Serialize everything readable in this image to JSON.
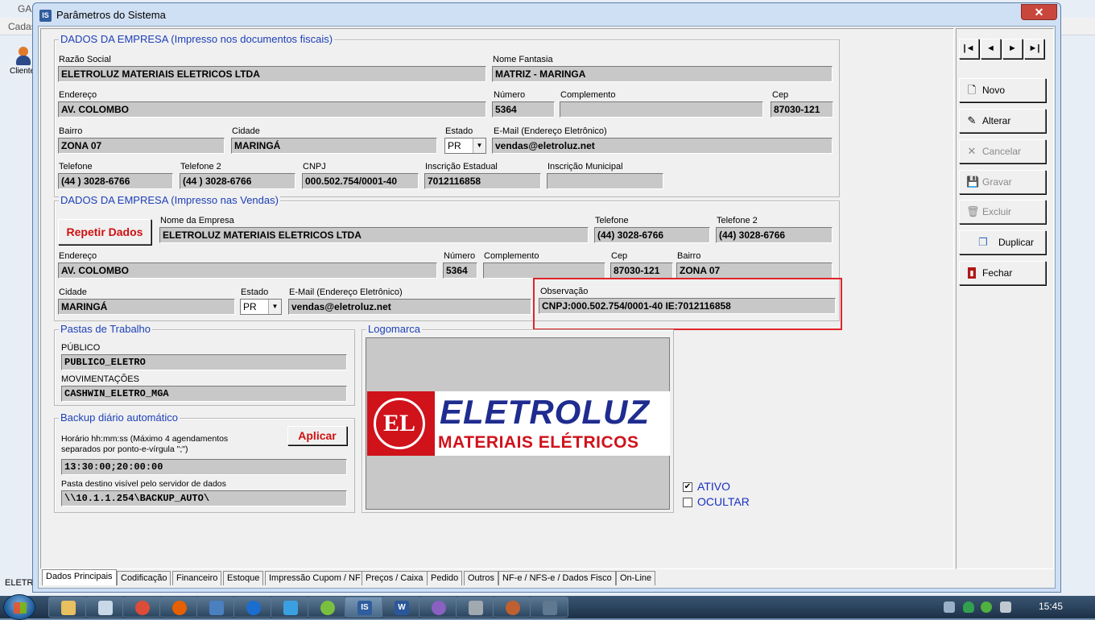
{
  "background_app": {
    "title_fragment": "GA",
    "menu_fragment": "Cadas",
    "client_label": "Cliente",
    "status_fragment": "ELETR"
  },
  "window": {
    "icon_text": "IS",
    "title": "Parâmetros do Sistema",
    "close_symbol": "✕"
  },
  "empresa_fiscal": {
    "group_title": "DADOS DA EMPRESA (Impresso nos documentos fiscais)",
    "razao_social_label": "Razão Social",
    "razao_social": "ELETROLUZ MATERIAIS ELETRICOS LTDA",
    "nome_fantasia_label": "Nome Fantasia",
    "nome_fantasia": "MATRIZ - MARINGA",
    "endereco_label": "Endereço",
    "endereco": "AV. COLOMBO",
    "numero_label": "Número",
    "numero": "5364",
    "complemento_label": "Complemento",
    "complemento": "",
    "cep_label": "Cep",
    "cep": "87030-121",
    "bairro_label": "Bairro",
    "bairro": "ZONA 07",
    "cidade_label": "Cidade",
    "cidade": "MARINGÁ",
    "estado_label": "Estado",
    "estado": "PR",
    "email_label": "E-Mail (Endereço Eletrônico)",
    "email": "vendas@eletroluz.net",
    "telefone_label": "Telefone",
    "telefone": "(44 ) 3028-6766",
    "telefone2_label": "Telefone 2",
    "telefone2": "(44 ) 3028-6766",
    "cnpj_label": "CNPJ",
    "cnpj": "000.502.754/0001-40",
    "ie_label": "Inscrição Estadual",
    "ie": "7012116858",
    "im_label": "Inscrição Municipal",
    "im": ""
  },
  "empresa_vendas": {
    "group_title": "DADOS DA EMPRESA (Impresso nas Vendas)",
    "repetir_button": "Repetir Dados",
    "nome_label": "Nome da Empresa",
    "nome": "ELETROLUZ MATERIAIS ELETRICOS LTDA",
    "telefone_label": "Telefone",
    "telefone": "(44) 3028-6766",
    "telefone2_label": "Telefone 2",
    "telefone2": "(44) 3028-6766",
    "endereco_label": "Endereço",
    "endereco": "AV. COLOMBO",
    "numero_label": "Número",
    "numero": "5364",
    "complemento_label": "Complemento",
    "complemento": "",
    "cep_label": "Cep",
    "cep": "87030-121",
    "bairro_label": "Bairro",
    "bairro": "ZONA 07",
    "cidade_label": "Cidade",
    "cidade": "MARINGÁ",
    "estado_label": "Estado",
    "estado": "PR",
    "email_label": "E-Mail (Endereço Eletrônico)",
    "email": "vendas@eletroluz.net",
    "observacao_label": "Observação",
    "observacao": "CNPJ:000.502.754/0001-40   IE:7012116858"
  },
  "pastas": {
    "group_title": "Pastas de Trabalho",
    "publico_label": "PÚBLICO",
    "publico": "PUBLICO_ELETRO",
    "movimentacoes_label": "MOVIMENTAÇÕES",
    "movimentacoes": "CASHWIN_ELETRO_MGA"
  },
  "backup": {
    "group_title": "Backup diário automático",
    "aplicar_button": "Aplicar",
    "horario_label": "Horário hh:mm:ss (Máximo 4 agendamentos separados por ponto-e-vírgula \";\")",
    "horario": "13:30:00;20:00:00",
    "pasta_label": "Pasta destino visível pelo servidor de dados",
    "pasta": "\\\\10.1.1.254\\BACKUP_AUTO\\"
  },
  "logomarca": {
    "group_title": "Logomarca",
    "logo_line1": "ELETROLUZ",
    "logo_line2": "MATERIAIS ELÉTRICOS",
    "logo_mark": "EL"
  },
  "flags": {
    "ativo_label": "ATIVO",
    "ativo_checked": true,
    "ocultar_label": "OCULTAR",
    "ocultar_checked": false
  },
  "toolbar": {
    "nav_first": "|◄",
    "nav_prev": "◄",
    "nav_next": "►",
    "nav_last": "►|",
    "novo": "Novo",
    "alterar": "Alterar",
    "cancelar": "Cancelar",
    "gravar": "Gravar",
    "excluir": "Excluir",
    "duplicar": "Duplicar",
    "fechar": "Fechar"
  },
  "tabs": [
    "Dados Principais",
    "Codificação",
    "Financeiro",
    "Estoque",
    "Impressão Cupom / NF",
    "Preços / Caixa",
    "Pedido",
    "Outros",
    "NF-e / NFS-e / Dados Fisco",
    "On-Line"
  ],
  "active_tab": "Dados Principais",
  "taskbar": {
    "clock": "15:45"
  },
  "colors": {
    "group_title": "#1c3fb8",
    "highlight_box": "#e0242a",
    "red_button_text": "#d01010",
    "logo_red": "#d0121b",
    "logo_blue": "#1f2c8f"
  }
}
